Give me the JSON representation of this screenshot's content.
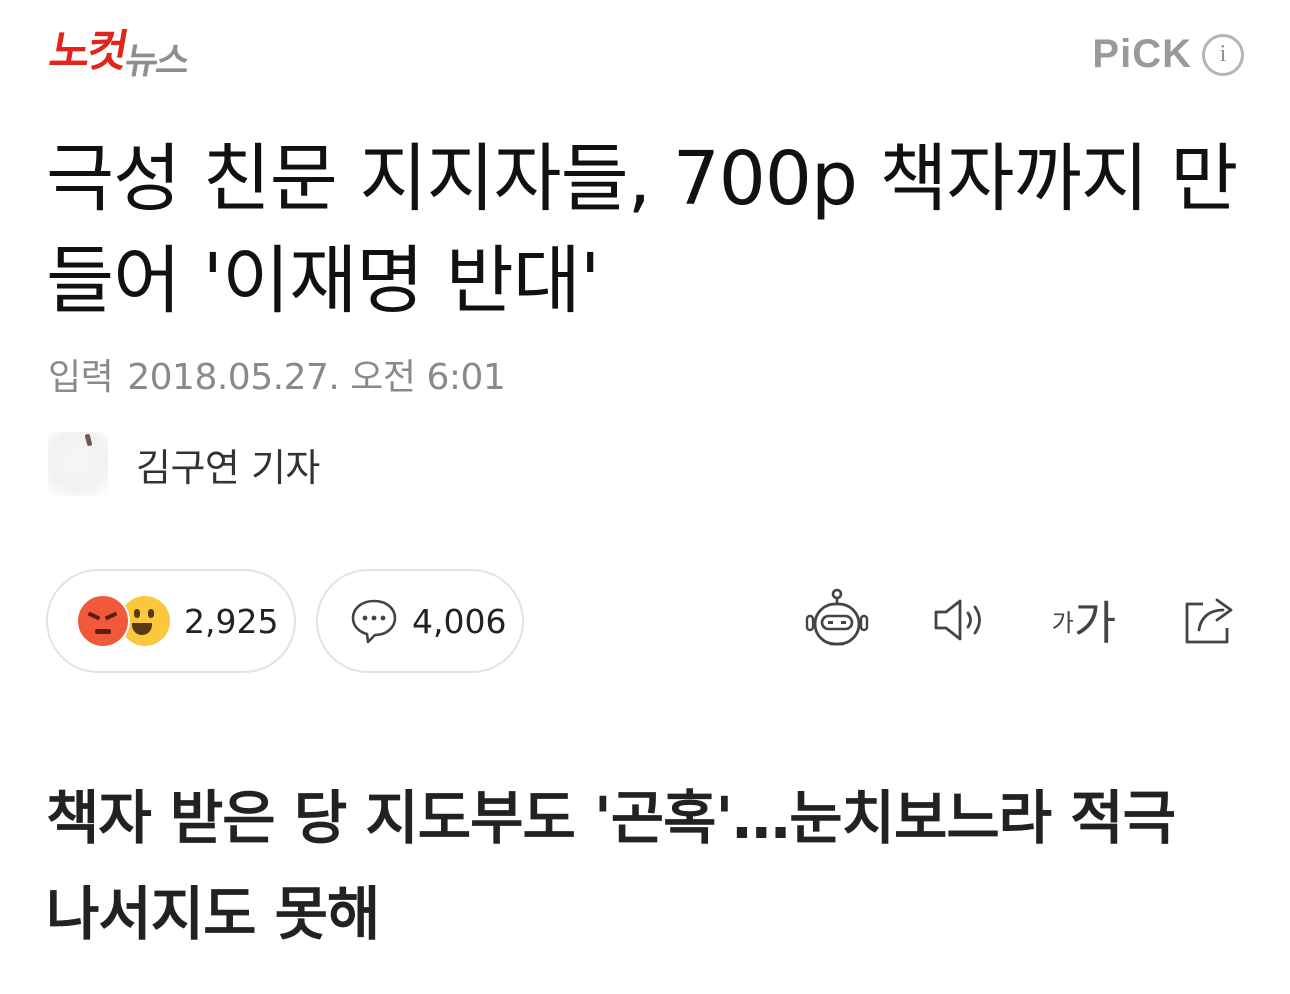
{
  "brand": {
    "logo_red": "노컷",
    "logo_gray": "뉴스"
  },
  "pick": {
    "label": "PiCK",
    "info_icon": "info-circle-icon",
    "info_glyph": "i"
  },
  "article": {
    "headline": "극성 친문 지지자들, 700p 책자까지 만들어 '이재명 반대'",
    "date_label": "입력",
    "date_value": "2018.05.27. 오전 6:01",
    "reporter": "김구연 기자",
    "subheadline": "책자 받은 당 지도부도 '곤혹'…눈치보느라 적극 나서지도 못해"
  },
  "engagement": {
    "reactions_count": "2,925",
    "reaction_icons": [
      "angry-face-icon",
      "laughing-face-icon"
    ],
    "comments_count": "4,006"
  },
  "tools": {
    "font_small": "가",
    "font_large": "가",
    "icons": [
      "summary-robot-icon",
      "text-to-speech-icon",
      "font-size-icon",
      "share-icon"
    ]
  },
  "colors": {
    "brand_red": "#e1251b",
    "brand_gray": "#8e8e8e",
    "pill_border": "#e3e3e3"
  }
}
